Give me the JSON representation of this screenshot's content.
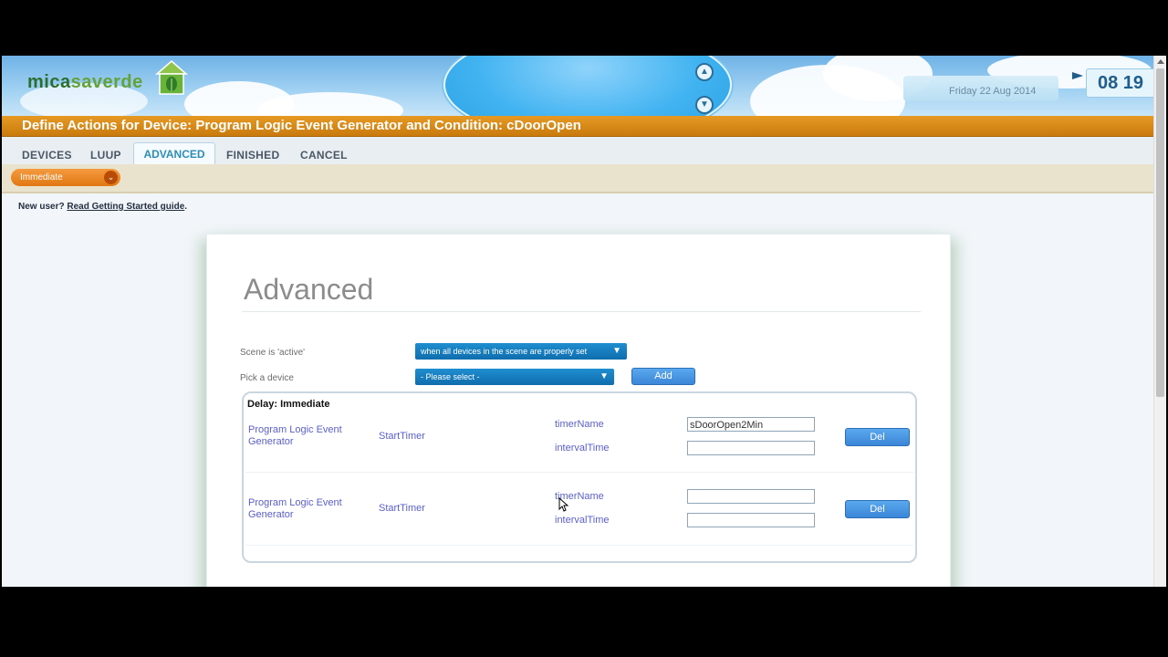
{
  "header": {
    "logo_text_a": "mica",
    "logo_text_b": "saverde",
    "date": "Friday 22 Aug 2014",
    "clock": "08 19"
  },
  "title": "Define Actions for Device: Program Logic Event Generator and Condition: cDoorOpen",
  "nav": {
    "tabs": [
      "DEVICES",
      "LUUP",
      "ADVANCED",
      "FINISHED",
      "CANCEL"
    ],
    "active": "ADVANCED"
  },
  "delay_select": "Immediate",
  "new_user": {
    "prefix": "New user?",
    "link": "Read Getting Started guide",
    "suffix": "."
  },
  "advanced": {
    "title": "Advanced",
    "scene_active_label": "Scene is 'active'",
    "scene_active_value": "when all devices in the scene are properly set",
    "pick_device_label": "Pick a device",
    "pick_device_value": "- Please select -",
    "add_button": "Add",
    "delay_heading": "Delay: Immediate",
    "actions": [
      {
        "device": "Program Logic Event Generator",
        "action": "StartTimer",
        "params": [
          {
            "name": "timerName",
            "value": "sDoorOpen2Min"
          },
          {
            "name": "intervalTime",
            "value": ""
          }
        ],
        "del": "Del"
      },
      {
        "device": "Program Logic Event Generator",
        "action": "StartTimer",
        "params": [
          {
            "name": "timerName",
            "value": ""
          },
          {
            "name": "intervalTime",
            "value": ""
          }
        ],
        "del": "Del"
      }
    ]
  },
  "colors": {
    "title_bar": "#d5860f",
    "select_blue": "#1479bd",
    "button_blue": "#4a96e2",
    "link_blue": "#5a5fd0"
  }
}
